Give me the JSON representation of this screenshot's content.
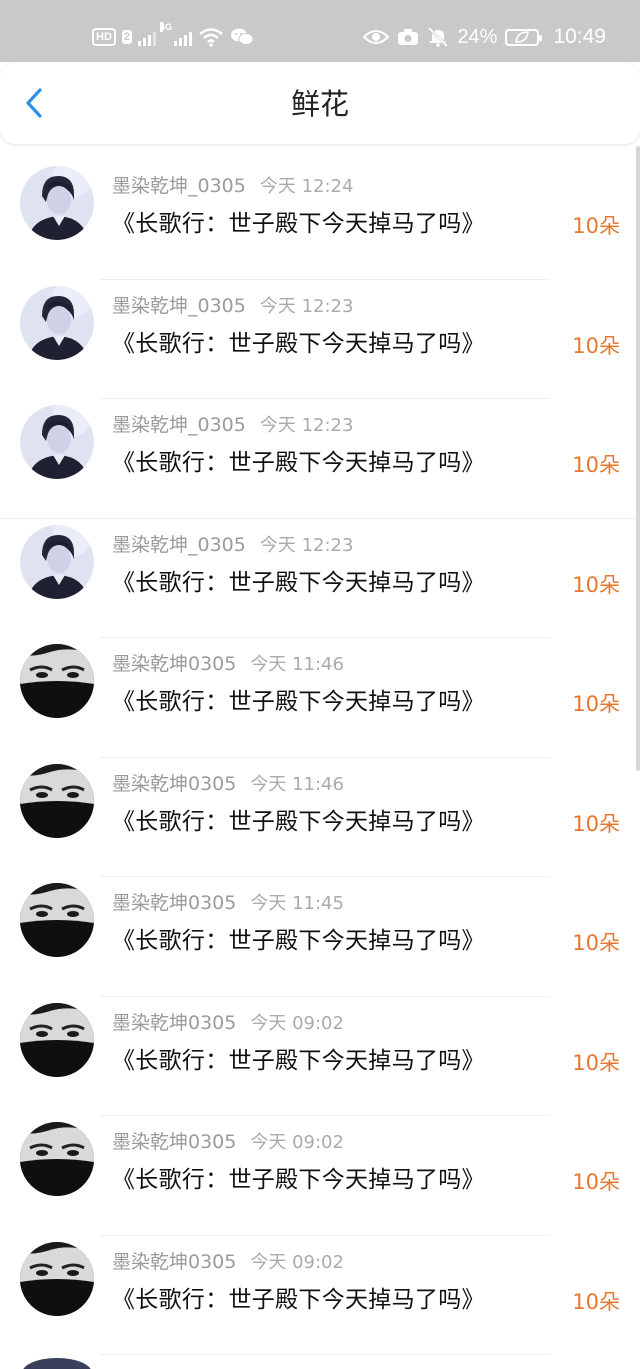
{
  "status_bar": {
    "hd_label": "HD",
    "sim_label": "2",
    "net_label": "4G",
    "battery_percent": "24%",
    "time": "10:49",
    "icons": [
      "eye-icon",
      "camera-icon",
      "mute-bell-icon",
      "battery-icon",
      "wifi-icon",
      "wechat-icon"
    ]
  },
  "header": {
    "title": "鲜花",
    "back_icon": "chevron-left-icon",
    "accent": "#2f8fe8"
  },
  "colors": {
    "amount": "#e8772e",
    "status_bar": "#c9c9c9"
  },
  "records": [
    {
      "user": "墨染乾坤_0305",
      "time": "今天 12:24",
      "book": "《长歌行：世子殿下今天掉马了吗》",
      "amount": "10朵",
      "avatar": "avatar-blue-portrait"
    },
    {
      "user": "墨染乾坤_0305",
      "time": "今天 12:23",
      "book": "《长歌行：世子殿下今天掉马了吗》",
      "amount": "10朵",
      "avatar": "avatar-blue-portrait"
    },
    {
      "user": "墨染乾坤_0305",
      "time": "今天 12:23",
      "book": "《长歌行：世子殿下今天掉马了吗》",
      "amount": "10朵",
      "avatar": "avatar-blue-portrait"
    },
    {
      "user": "墨染乾坤_0305",
      "time": "今天 12:23",
      "book": "《长歌行：世子殿下今天掉马了吗》",
      "amount": "10朵",
      "avatar": "avatar-blue-portrait"
    },
    {
      "user": "墨染乾坤0305",
      "time": "今天 11:46",
      "book": "《长歌行：世子殿下今天掉马了吗》",
      "amount": "10朵",
      "avatar": "avatar-masked-portrait"
    },
    {
      "user": "墨染乾坤0305",
      "time": "今天 11:46",
      "book": "《长歌行：世子殿下今天掉马了吗》",
      "amount": "10朵",
      "avatar": "avatar-masked-portrait"
    },
    {
      "user": "墨染乾坤0305",
      "time": "今天 11:45",
      "book": "《长歌行：世子殿下今天掉马了吗》",
      "amount": "10朵",
      "avatar": "avatar-masked-portrait"
    },
    {
      "user": "墨染乾坤0305",
      "time": "今天 09:02",
      "book": "《长歌行：世子殿下今天掉马了吗》",
      "amount": "10朵",
      "avatar": "avatar-masked-portrait"
    },
    {
      "user": "墨染乾坤0305",
      "time": "今天 09:02",
      "book": "《长歌行：世子殿下今天掉马了吗》",
      "amount": "10朵",
      "avatar": "avatar-masked-portrait"
    },
    {
      "user": "墨染乾坤0305",
      "time": "今天 09:02",
      "book": "《长歌行：世子殿下今天掉马了吗》",
      "amount": "10朵",
      "avatar": "avatar-masked-portrait"
    }
  ]
}
